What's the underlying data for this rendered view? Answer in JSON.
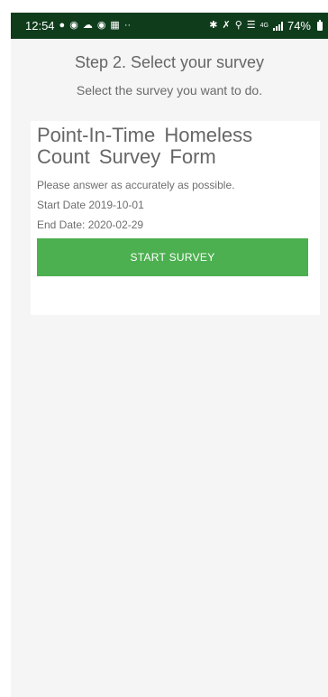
{
  "status_bar": {
    "time": "12:54",
    "left_icons": [
      "whatsapp-icon",
      "messenger-icon",
      "cloud-icon",
      "chat-icon",
      "gallery-icon"
    ],
    "overflow": "··",
    "network_label": "4G",
    "battery": "74%"
  },
  "header": {
    "title": "Step 2. Select your survey",
    "subtitle": "Select the survey you want to do."
  },
  "survey": {
    "title": "Point-In-Time Homeless Count Survey Form",
    "description": "Please answer as accurately as possible.",
    "start_date": "Start Date 2019-10-01",
    "end_date": "End Date: 2020-02-29",
    "button_label": "START SURVEY"
  },
  "colors": {
    "status_bar_bg": "#0f3d1c",
    "button_bg": "#4cb050",
    "screen_bg": "#f5f5f5"
  }
}
